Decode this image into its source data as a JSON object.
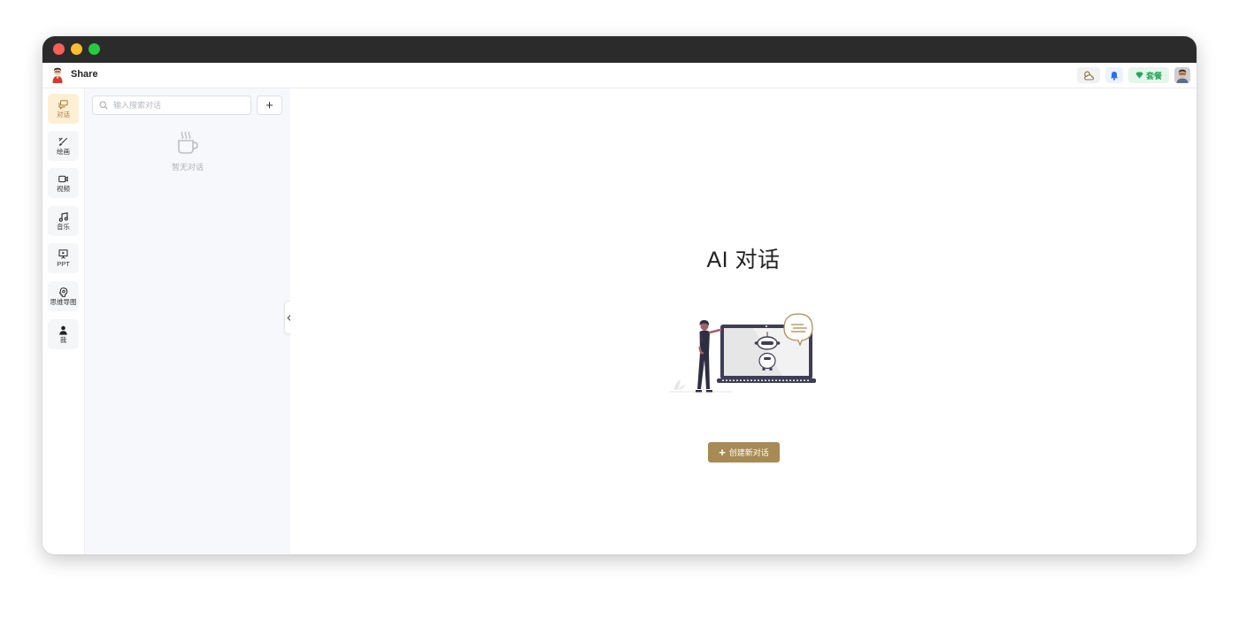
{
  "app": {
    "name": "Share"
  },
  "header": {
    "plan_label": "套餐"
  },
  "nav": {
    "items": [
      {
        "label": "对话",
        "icon": "chat-icon",
        "active": true
      },
      {
        "label": "绘画",
        "icon": "paint-brush-icon",
        "active": false
      },
      {
        "label": "视频",
        "icon": "video-icon",
        "active": false
      },
      {
        "label": "音乐",
        "icon": "music-note-icon",
        "active": false
      },
      {
        "label": "PPT",
        "icon": "presentation-icon",
        "active": false
      },
      {
        "label": "思维导图",
        "icon": "mind-map-icon",
        "active": false
      },
      {
        "label": "我",
        "icon": "user-icon",
        "active": false
      }
    ]
  },
  "sidebar": {
    "search_placeholder": "输入搜索对话",
    "add_label": "+",
    "empty_text": "暂无对话"
  },
  "main": {
    "title": "AI 对话",
    "new_button": "创建新对话"
  },
  "colors": {
    "accent": "#a78a55",
    "active_nav_bg": "#fdefd3",
    "plan_green": "#27a55a"
  }
}
